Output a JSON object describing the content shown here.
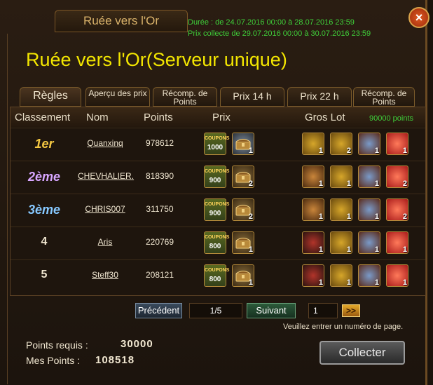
{
  "window": {
    "tab_title": "Ruée vers l'Or",
    "duration": "Durée : de 24.07.2016 00:00 à 28.07.2016 23:59",
    "collect_period": "Prix collecte de 29.07.2016 00:00 à 30.07.2016 23:59",
    "close_label": "×",
    "main_title": "Ruée vers l'Or(Serveur unique)"
  },
  "tabs": [
    {
      "label": "Règles"
    },
    {
      "label": "Aperçu des prix"
    },
    {
      "label": "Récomp. de Points"
    },
    {
      "label": "Prix 14 h"
    },
    {
      "label": "Prix 22 h"
    },
    {
      "label": "Récomp. de Points"
    }
  ],
  "table": {
    "headers": {
      "rank": "Classement",
      "name": "Nom",
      "points": "Points",
      "prize": "Prix",
      "jackpot": "Gros Lot"
    },
    "jackpot_points": "90000 points",
    "coupons_text": "COUPONS",
    "rows": [
      {
        "rank": "1er",
        "name": "Quanxinq",
        "points": "978612",
        "coupons": "1000",
        "chest_qty": "1",
        "jackpot_qty": [
          "1",
          "2",
          "1",
          "1"
        ]
      },
      {
        "rank": "2ème",
        "name": "CHEVHALIER.",
        "points": "818390",
        "coupons": "900",
        "chest_qty": "2",
        "jackpot_qty": [
          "1",
          "1",
          "1",
          "2"
        ]
      },
      {
        "rank": "3ème",
        "name": "CHRIS007",
        "points": "311750",
        "coupons": "900",
        "chest_qty": "2",
        "jackpot_qty": [
          "1",
          "1",
          "1",
          "2"
        ]
      },
      {
        "rank": "4",
        "name": "Aris",
        "points": "220769",
        "coupons": "800",
        "chest_qty": "1",
        "jackpot_qty": [
          "1",
          "1",
          "1",
          "1"
        ]
      },
      {
        "rank": "5",
        "name": "Steff30",
        "points": "208121",
        "coupons": "800",
        "chest_qty": "1",
        "jackpot_qty": [
          "1",
          "1",
          "1",
          "1"
        ]
      }
    ]
  },
  "pager": {
    "prev": "Précédent",
    "page": "1/5",
    "next": "Suivant",
    "input_value": "1",
    "go": ">>",
    "hint": "Veuillez entrer un numéro de page."
  },
  "footer": {
    "req_label": "Points requis :",
    "req_value": "30000",
    "my_label": "Mes Points :",
    "my_value": "108518",
    "collect": "Collecter"
  }
}
